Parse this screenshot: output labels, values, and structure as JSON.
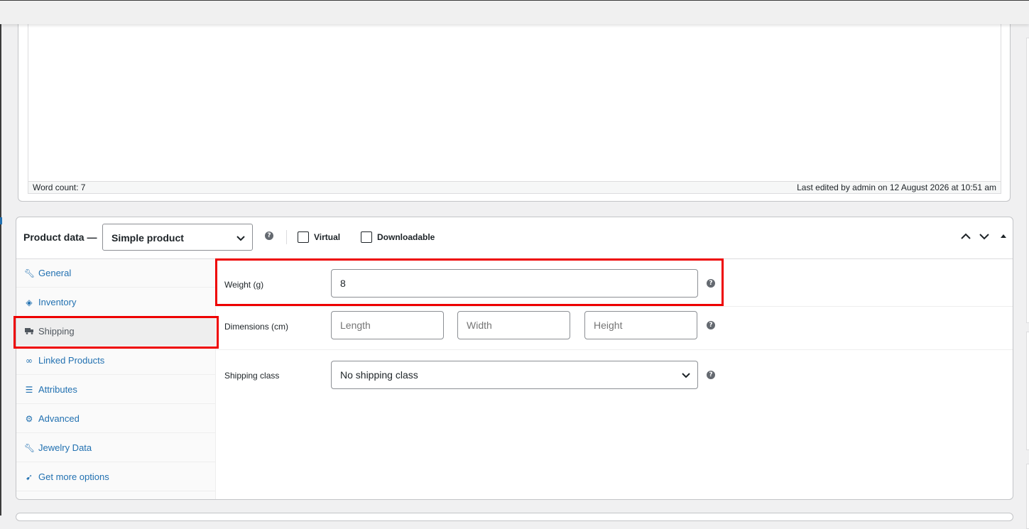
{
  "editor": {
    "word_count": "Word count: 7",
    "last_edited": "Last edited by admin on 12 August 2026 at 10:51 am"
  },
  "product_data": {
    "title": "Product data —",
    "type_select": "Simple product",
    "virtual_label": "Virtual",
    "downloadable_label": "Downloadable",
    "help_glyph": "?",
    "tabs": [
      {
        "label": "General",
        "icon": "wrench-icon"
      },
      {
        "label": "Inventory",
        "icon": "tag-icon"
      },
      {
        "label": "Shipping",
        "icon": "truck-icon",
        "active": true
      },
      {
        "label": "Linked Products",
        "icon": "link-icon"
      },
      {
        "label": "Attributes",
        "icon": "list-icon"
      },
      {
        "label": "Advanced",
        "icon": "gear-icon"
      },
      {
        "label": "Jewelry Data",
        "icon": "wrench-icon"
      },
      {
        "label": "Get more options",
        "icon": "plugin-icon"
      }
    ],
    "shipping": {
      "weight_label": "Weight (g)",
      "weight_value": "8",
      "dimensions_label": "Dimensions (cm)",
      "length_placeholder": "Length",
      "width_placeholder": "Width",
      "height_placeholder": "Height",
      "class_label": "Shipping class",
      "class_value": "No shipping class"
    }
  },
  "colors": {
    "accent": "#2271b1",
    "highlight": "#e00000"
  }
}
